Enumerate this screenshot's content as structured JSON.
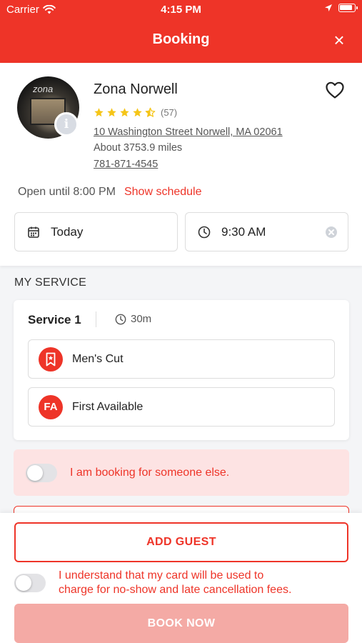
{
  "status_bar": {
    "carrier": "Carrier",
    "time": "4:15 PM",
    "battery_level": 0.9
  },
  "header": {
    "title": "Booking",
    "close_label": "×"
  },
  "business": {
    "name": "Zona Norwell",
    "rating": 4.5,
    "review_count": "(57)",
    "address": "10 Washington Street Norwell, MA 02061",
    "distance": "About 3753.9 miles",
    "phone": "781-871-4545",
    "hours": "Open until 8:00 PM",
    "schedule_link": "Show schedule",
    "avatar_sign": "zona"
  },
  "date_field": {
    "value": "Today"
  },
  "time_field": {
    "value": "9:30 AM"
  },
  "section_title": "MY SERVICE",
  "service": {
    "label": "Service 1",
    "duration": "30m",
    "name": "Men's Cut",
    "staff_initials": "FA",
    "staff": "First Available"
  },
  "booking_for_other": {
    "label": "I am booking for someone else.",
    "enabled": false
  },
  "footer": {
    "add_guest": "ADD GUEST",
    "consent_line1": "I understand that my card will be used to",
    "consent_line2": "charge for no-show and late cancellation fees.",
    "consent_enabled": false,
    "book_now": "BOOK NOW"
  },
  "colors": {
    "brand": "#ee3428",
    "highlight_bg": "#fde3e3",
    "star": "#f5c518",
    "disabled_button": "#f4aaa5"
  },
  "icons": [
    "wifi-icon",
    "location-arrow-icon",
    "battery-icon",
    "close-icon",
    "info-icon",
    "heart-icon",
    "star-icon",
    "calendar-icon",
    "clock-icon",
    "clear-icon",
    "bookmark-icon"
  ]
}
